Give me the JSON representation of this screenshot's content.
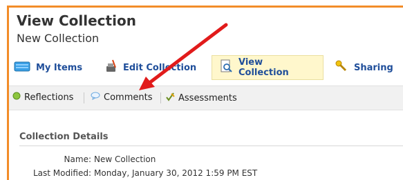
{
  "page": {
    "title": "View Collection",
    "subtitle": "New Collection"
  },
  "tabs": [
    {
      "label": "My Items",
      "icon": "folder-icon"
    },
    {
      "label": "Edit Collection",
      "icon": "edit-collection-icon"
    },
    {
      "label": "View Collection",
      "icon": "view-document-icon"
    },
    {
      "label": "Sharing",
      "icon": "key-icon"
    }
  ],
  "subnav": [
    {
      "label": "Reflections",
      "icon": "green-ball-icon"
    },
    {
      "label": "Comments",
      "icon": "speech-bubble-icon"
    },
    {
      "label": "Assessments",
      "icon": "checkmark-pencil-icon"
    }
  ],
  "details": {
    "heading": "Collection Details",
    "name_label": "Name:",
    "name_value": "New Collection",
    "modified_label": "Last Modified:",
    "modified_value": "Monday, January 30, 2012 1:59 PM EST"
  },
  "colors": {
    "frame": "#f28c28",
    "tab_text": "#1f4e9a",
    "active_tab_bg": "#fff7cc",
    "annotation_arrow": "#e11b1b"
  }
}
